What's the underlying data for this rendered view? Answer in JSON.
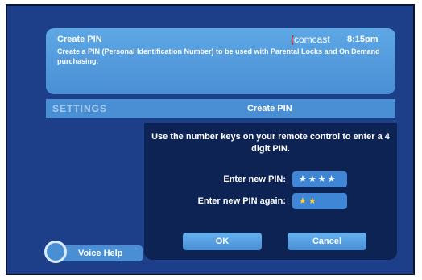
{
  "header": {
    "title": "Create PIN",
    "brand": "comcast",
    "time": "8:15pm",
    "description": "Create a PIN (Personal Identification Number) to be used with Parental Locks and On Demand purchasing."
  },
  "bar": {
    "section": "SETTINGS",
    "title": "Create PIN"
  },
  "dialog": {
    "message": "Use the number keys on your remote control to enter a 4 digit PIN.",
    "pin_label": "Enter new PIN:",
    "pin_value": "★★★★",
    "pin_again_label": "Enter new PIN again:",
    "pin_again_value": "★★",
    "ok_label": "OK",
    "cancel_label": "Cancel"
  },
  "voice_help": {
    "label": "Voice Help"
  },
  "colors": {
    "background": "#1d3f8a",
    "panel": "#4a8fd4",
    "dialog": "#0d2354",
    "active_pin": "#ffd83a",
    "brand_swoosh": "#d8202a"
  }
}
